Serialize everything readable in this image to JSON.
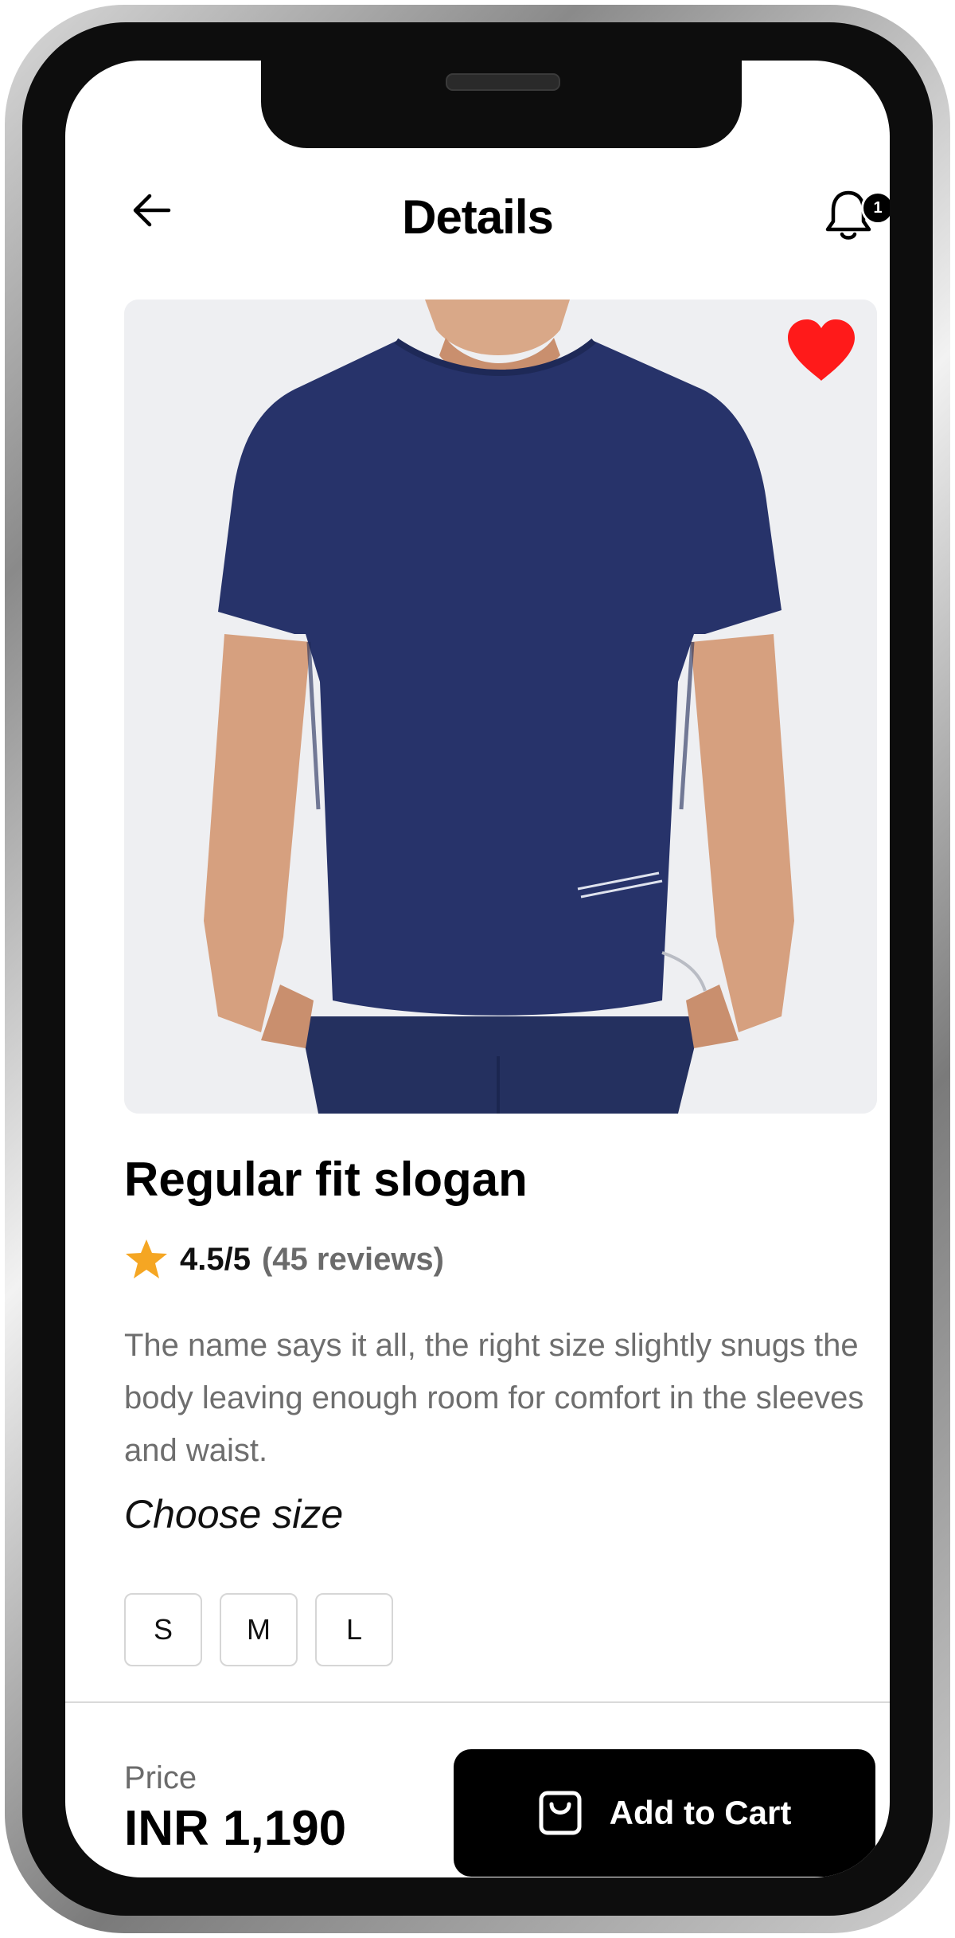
{
  "header": {
    "title": "Details",
    "back_icon": "arrow-left-icon",
    "notification_icon": "bell-icon",
    "notification_count": "1"
  },
  "product": {
    "image_icon": "product-photo-navy-tshirt",
    "favorite_icon": "heart-icon",
    "name": "Regular fit slogan",
    "rating_icon": "star-icon",
    "rating": "4.5/5",
    "reviews": "(45 reviews)",
    "description": "The name says it all, the right size slightly snugs the body leaving enough room for comfort in the sleeves and waist."
  },
  "size_selector": {
    "title": "Choose size",
    "options": [
      "S",
      "M",
      "L"
    ]
  },
  "footer": {
    "price_label": "Price",
    "price_value": "INR 1,190",
    "cart_icon": "shopping-bag-icon",
    "cart_label": "Add to Cart"
  },
  "colors": {
    "favorite": "#ff1a1a",
    "star": "#f5a623",
    "shirt": "#27336a",
    "primary_button": "#000000"
  }
}
